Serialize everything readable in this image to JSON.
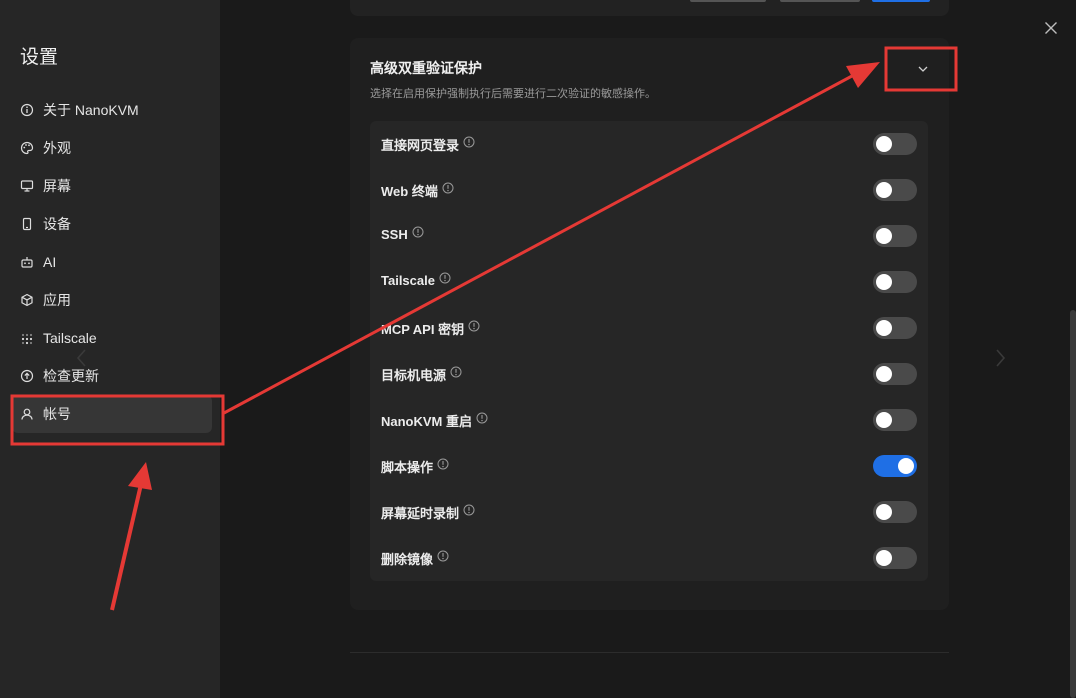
{
  "sidebar": {
    "title": "设置",
    "items": [
      {
        "label": "关于 NanoKVM",
        "icon": "info-icon",
        "active": false
      },
      {
        "label": "外观",
        "icon": "palette-icon",
        "active": false
      },
      {
        "label": "屏幕",
        "icon": "monitor-icon",
        "active": false
      },
      {
        "label": "设备",
        "icon": "device-icon",
        "active": false
      },
      {
        "label": "AI",
        "icon": "robot-icon",
        "active": false
      },
      {
        "label": "应用",
        "icon": "package-icon",
        "active": false
      },
      {
        "label": "Tailscale",
        "icon": "tailscale-icon",
        "active": false
      },
      {
        "label": "检查更新",
        "icon": "update-icon",
        "active": false
      },
      {
        "label": "帐号",
        "icon": "user-icon",
        "active": true
      }
    ]
  },
  "section": {
    "title": "高级双重验证保护",
    "description": "选择在启用保护强制执行后需要进行二次验证的敏感操作。",
    "rows": [
      {
        "label": "直接网页登录",
        "enabled": false
      },
      {
        "label": "Web 终端",
        "enabled": false
      },
      {
        "label": "SSH",
        "enabled": false
      },
      {
        "label": "Tailscale",
        "enabled": false
      },
      {
        "label": "MCP API 密钥",
        "enabled": false
      },
      {
        "label": "目标机电源",
        "enabled": false
      },
      {
        "label": "NanoKVM 重启",
        "enabled": false
      },
      {
        "label": "脚本操作",
        "enabled": true
      },
      {
        "label": "屏幕延时录制",
        "enabled": false
      },
      {
        "label": "删除镜像",
        "enabled": false
      }
    ]
  },
  "colors": {
    "accent": "#1f6fe5",
    "annotation": "#e53935"
  }
}
